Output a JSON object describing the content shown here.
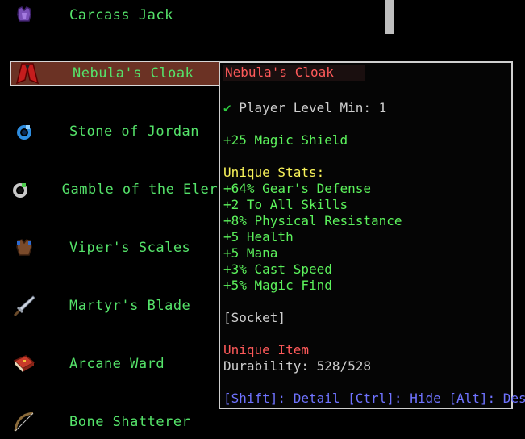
{
  "items": [
    {
      "name": "Carcass Jack",
      "icon": "purple-armor-icon"
    },
    {
      "name": "Nebula's Cloak",
      "icon": "red-cloak-icon"
    },
    {
      "name": "Stone of Jordan",
      "icon": "blue-ring-icon"
    },
    {
      "name": "Gamble of the Eler",
      "icon": "silver-ring-icon"
    },
    {
      "name": "Viper's Scales",
      "icon": "brown-armor-icon"
    },
    {
      "name": "Martyr's Blade",
      "icon": "sword-icon"
    },
    {
      "name": "Arcane Ward",
      "icon": "red-book-icon"
    },
    {
      "name": "Bone Shatterer",
      "icon": "bow-icon"
    }
  ],
  "tooltip": {
    "title": "Nebula's Cloak",
    "level_req": "Player Level Min: 1",
    "magic_shield": "+25 Magic Shield",
    "unique_header": "Unique Stats:",
    "stats": [
      "+64% Gear's Defense",
      "+2 To All Skills",
      "+8% Physical Resistance",
      "+5 Health",
      "+5 Mana",
      "+3% Cast Speed",
      "+5% Magic Find"
    ],
    "socket": "[Socket]",
    "rarity": "Unique Item",
    "durability": "Durability: 528/528",
    "hints": "[Shift]: Detail [Ctrl]: Hide [Alt]: Desc"
  }
}
